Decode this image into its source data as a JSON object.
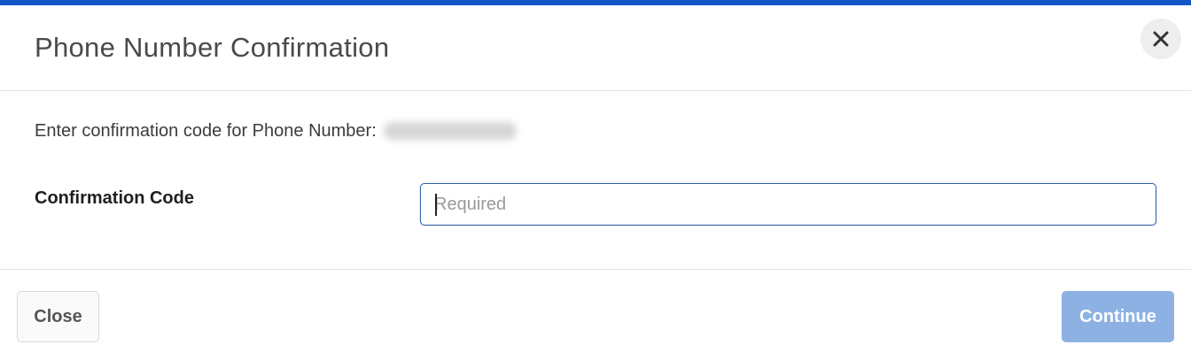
{
  "dialog": {
    "title": "Phone Number Confirmation",
    "close_icon": "close-icon",
    "accent_color": "#1155c6"
  },
  "body": {
    "prompt_text": "Enter confirmation code for Phone Number:",
    "phone_number_obscured": true,
    "field_label": "Confirmation Code",
    "field_value": "",
    "field_placeholder": "Required"
  },
  "footer": {
    "close_label": "Close",
    "continue_label": "Continue",
    "continue_disabled": true,
    "continue_color": "#8eb1e3"
  }
}
